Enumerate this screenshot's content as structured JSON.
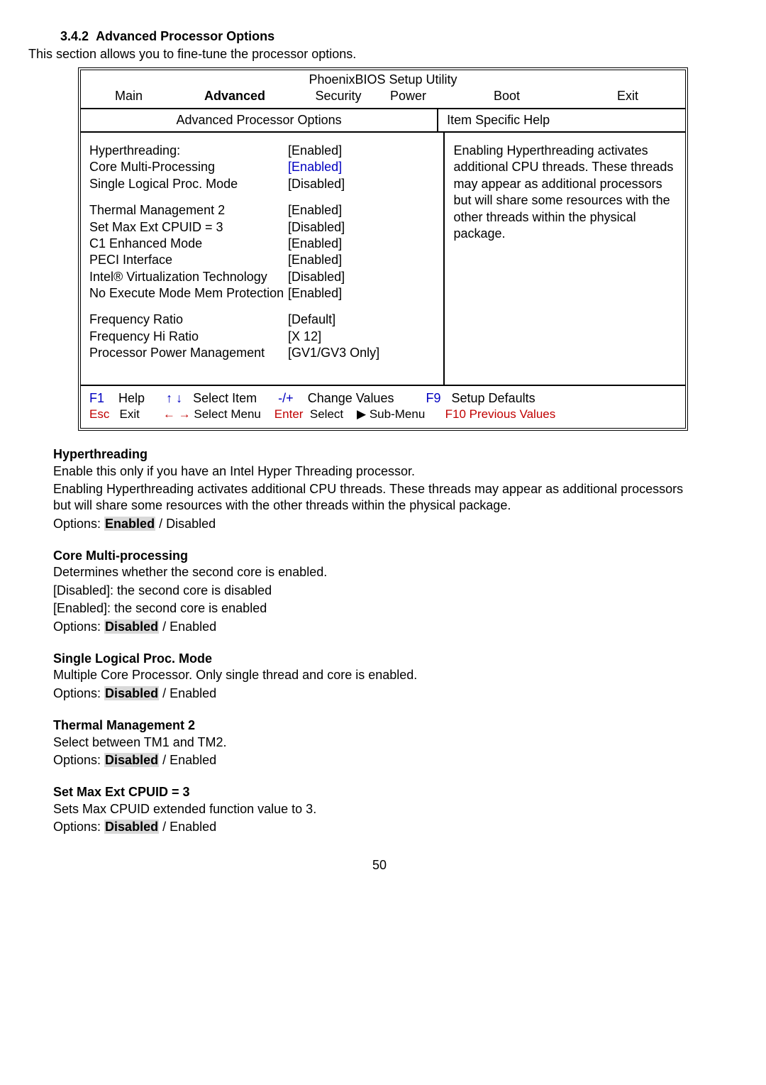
{
  "section": {
    "number": "3.4.2",
    "title": "Advanced Processor Options",
    "desc": "This section allows you to fine-tune the processor options."
  },
  "bios": {
    "utility": "PhoenixBIOS Setup Utility",
    "tabs": {
      "main": "Main",
      "advanced": "Advanced",
      "security": "Security",
      "power": "Power",
      "boot": "Boot",
      "exit": "Exit"
    },
    "subheader": {
      "left": "Advanced Processor Options",
      "right": "Item Specific Help"
    },
    "settings": [
      {
        "label": "Hyperthreading:",
        "value": "[Enabled]"
      },
      {
        "label": "Core Multi-Processing",
        "value": "[Enabled]",
        "blue": true
      },
      {
        "label": "Single Logical Proc. Mode",
        "value": "[Disabled]"
      }
    ],
    "settings2": [
      {
        "label": "Thermal Management 2",
        "value": "[Enabled]"
      },
      {
        "label": "Set Max Ext CPUID = 3",
        "value": "[Disabled]"
      },
      {
        "label": "C1 Enhanced Mode",
        "value": "[Enabled]"
      },
      {
        "label": "PECI Interface",
        "value": "[Enabled]"
      },
      {
        "label": "Intel® Virtualization Technology",
        "value": "[Disabled]"
      },
      {
        "label": "No Execute Mode Mem Protection",
        "value": "[Enabled]"
      }
    ],
    "settings3": [
      {
        "label": "Frequency Ratio",
        "value": "[Default]"
      },
      {
        "label": "Frequency Hi Ratio",
        "value": "[X 12]"
      },
      {
        "label": "Processor Power Management",
        "value": "[GV1/GV3 Only]"
      }
    ],
    "help": "Enabling Hyperthreading activates additional CPU threads.  These threads may appear as additional processors but will share some resources with the other threads within the physical package.",
    "footer": {
      "f1": "F1",
      "help": "Help",
      "arrows_ud": "↑ ↓",
      "select_item": "Select Item",
      "pm": "-/+",
      "change_values": "Change Values",
      "f9": "F9",
      "setup_defaults": "Setup Defaults",
      "esc": "Esc",
      "exit": "Exit",
      "arrows_lr": "← →",
      "select_menu": "Select Menu",
      "enter": "Enter",
      "select": "Select",
      "sub_menu": "▶ Sub-Menu",
      "f10": "F10",
      "prev_values": "Previous Values"
    }
  },
  "opts": [
    {
      "title": "Hyperthreading",
      "lines": [
        "Enable this only if you have an Intel Hyper Threading processor.",
        "Enabling Hyperthreading activates additional CPU threads.  These threads may appear as additional processors but will share some resources with the other threads within the physical package."
      ],
      "options_prefix": "Options: ",
      "hl": "Enabled",
      "options_suffix": " / Disabled"
    },
    {
      "title": "Core Multi-processing",
      "lines": [
        "Determines whether the second core is enabled.",
        "[Disabled]: the second core is disabled",
        "[Enabled]: the second core is enabled"
      ],
      "options_prefix": "Options: ",
      "hl": "Disabled",
      "options_suffix": " / Enabled"
    },
    {
      "title": "Single Logical Proc. Mode",
      "lines": [
        "Multiple Core Processor.  Only single thread and core is enabled."
      ],
      "options_prefix": "Options: ",
      "hl": "Disabled",
      "options_suffix": " / Enabled"
    },
    {
      "title": "Thermal Management 2",
      "lines": [
        "Select between TM1 and TM2."
      ],
      "options_prefix": "Options: ",
      "hl": "Disabled",
      "options_suffix": " / Enabled"
    },
    {
      "title": "Set Max Ext CPUID = 3",
      "lines": [
        "Sets Max CPUID extended function value to 3."
      ],
      "options_prefix": "Options: ",
      "hl": "Disabled",
      "options_suffix": " / Enabled"
    }
  ],
  "page": "50"
}
